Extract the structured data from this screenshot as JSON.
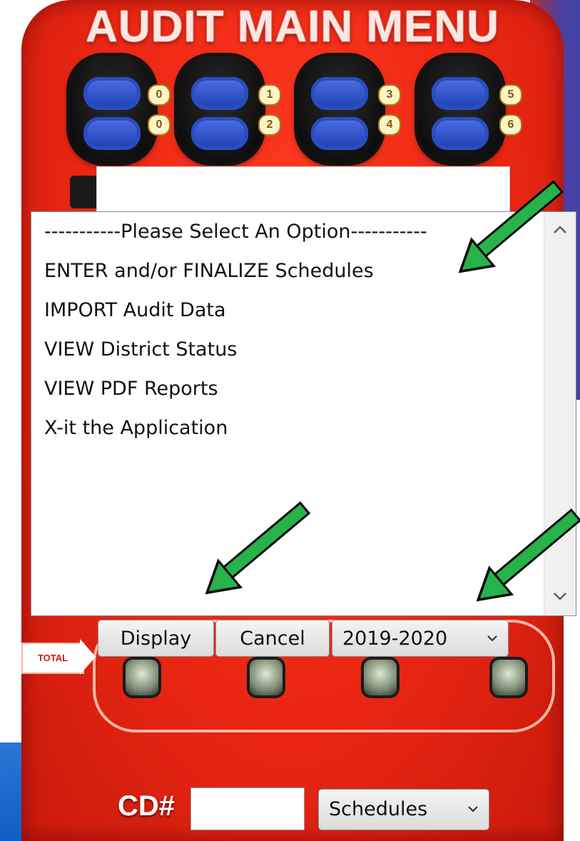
{
  "app": {
    "title": "AUDIT MAIN MENU"
  },
  "dial_numbers": [
    {
      "top": "0",
      "bottom": "0"
    },
    {
      "top": "1",
      "bottom": "2"
    },
    {
      "top": "3",
      "bottom": "4"
    },
    {
      "top": "5",
      "bottom": "6"
    }
  ],
  "top_field": {
    "value": ""
  },
  "menu": {
    "options": [
      "-----------Please Select An Option-----------",
      "ENTER and/or FINALIZE Schedules",
      "IMPORT Audit Data",
      "VIEW District Status",
      "VIEW PDF Reports",
      "X-it the Application"
    ]
  },
  "scrollbar": {
    "up_icon": "chevron-up-icon",
    "down_icon": "chevron-down-icon"
  },
  "buttons": {
    "display_label": "Display",
    "cancel_label": "Cancel"
  },
  "year_select": {
    "value": "2019-2020"
  },
  "total_label": "TOTAL",
  "cd": {
    "label": "CD#",
    "value": ""
  },
  "schedules_select": {
    "value": "Schedules"
  },
  "colors": {
    "device_red": "#ea2613",
    "arrow_green": "#27b34a",
    "dial_blue": "#2a4cc3"
  }
}
